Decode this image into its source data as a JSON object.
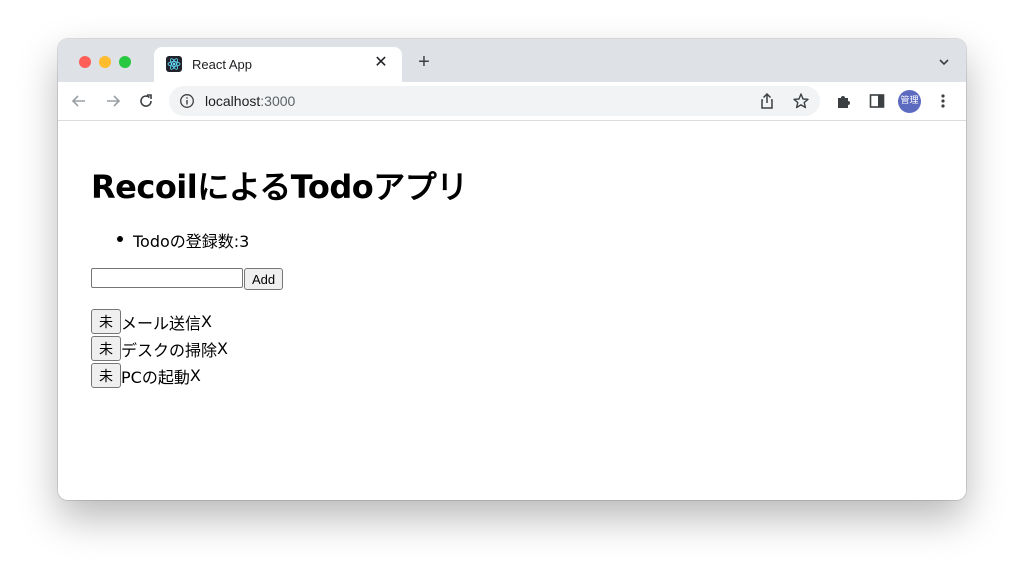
{
  "browser": {
    "tab_title": "React App",
    "tab_close": "✕",
    "new_tab": "+",
    "url_host": "localhost",
    "url_port": ":3000",
    "avatar_text": "管理",
    "icons": [
      "react-logo-icon",
      "chevron-down-icon",
      "back-arrow-icon",
      "forward-arrow-icon",
      "reload-icon",
      "info-icon",
      "share-icon",
      "star-icon",
      "extensions-icon",
      "side-panel-icon",
      "more-menu-icon"
    ]
  },
  "app": {
    "title": "RecoilによるTodoアプリ",
    "count_label": "Todoの登録数:3",
    "input_value": "",
    "add_label": "Add",
    "todos": [
      {
        "status": "未",
        "text": "メール送信",
        "delete": "X"
      },
      {
        "status": "未",
        "text": "デスクの掃除",
        "delete": "X"
      },
      {
        "status": "未",
        "text": "PCの起動",
        "delete": "X"
      }
    ]
  }
}
